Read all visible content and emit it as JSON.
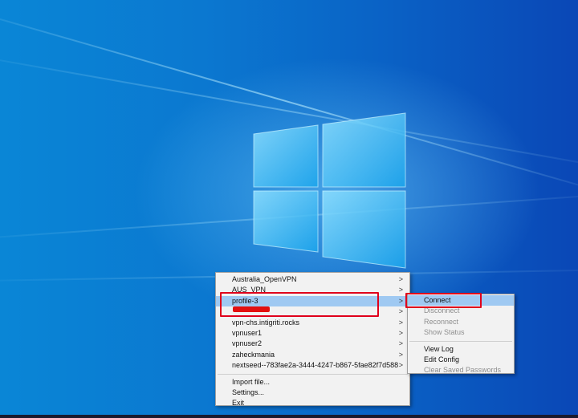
{
  "tray_menu": {
    "items": [
      {
        "label": "Australia_OpenVPN",
        "has_submenu": true,
        "highlighted": false
      },
      {
        "label": "AUS_VPN",
        "has_submenu": true,
        "highlighted": false
      },
      {
        "label": "profile-3",
        "has_submenu": true,
        "highlighted": true
      },
      {
        "label": "",
        "has_submenu": true,
        "highlighted": false,
        "redacted": true
      },
      {
        "label": "vpn-chs.intigriti.rocks",
        "has_submenu": true,
        "highlighted": false
      },
      {
        "label": "vpnuser1",
        "has_submenu": true,
        "highlighted": false
      },
      {
        "label": "vpnuser2",
        "has_submenu": true,
        "highlighted": false
      },
      {
        "label": "zaheckmania",
        "has_submenu": true,
        "highlighted": false
      },
      {
        "label": "nextseed--783fae2a-3444-4247-b867-5fae82f7d588",
        "has_submenu": true,
        "highlighted": false
      }
    ],
    "import_label": "Import file...",
    "settings_label": "Settings...",
    "exit_label": "Exit",
    "submenu_arrow": ">"
  },
  "submenu": {
    "connect": "Connect",
    "disconnect": "Disconnect",
    "reconnect": "Reconnect",
    "show_status": "Show Status",
    "view_log": "View Log",
    "edit_config": "Edit Config",
    "clear_passwords": "Clear Saved Passwords"
  },
  "colors": {
    "highlight": "#9fc9f2",
    "annotation_red": "#e0001b",
    "menu_bg": "#f2f2f2",
    "disabled_text": "#8e8e8e"
  }
}
